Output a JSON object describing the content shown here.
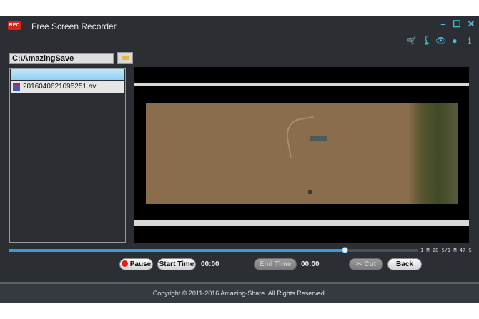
{
  "app": {
    "logo_text": "REC",
    "title": "Free Screen Recorder"
  },
  "window_controls": {
    "minimize": "minimize-icon",
    "maximize": "maximize-icon",
    "close": "close-icon"
  },
  "toolbar_icons": [
    "cart-icon",
    "thermometer-icon",
    "eye-icon",
    "skin-icon",
    "info-icon"
  ],
  "save_path": "C:\\AmazingSave",
  "file_list": {
    "items": [
      {
        "name": "2016040621095251.avi"
      }
    ]
  },
  "player": {
    "progress": 0.82,
    "time_readout": "1 M 28 S/1 M 47 S"
  },
  "controls": {
    "pause_label": "Pause",
    "start_time_label": "Start Time",
    "start_time_value": "00:00",
    "end_time_label": "End Time",
    "end_time_value": "00:00",
    "cut_label": "Cut",
    "back_label": "Back"
  },
  "footer": {
    "copyright": "Copyright © 2011-2016 Amazing-Share. All Rights Reserved."
  },
  "colors": {
    "accent": "#3fc3dc",
    "progress": "#3d9ad9",
    "rec": "#d9231c",
    "background": "#2b2f33"
  }
}
